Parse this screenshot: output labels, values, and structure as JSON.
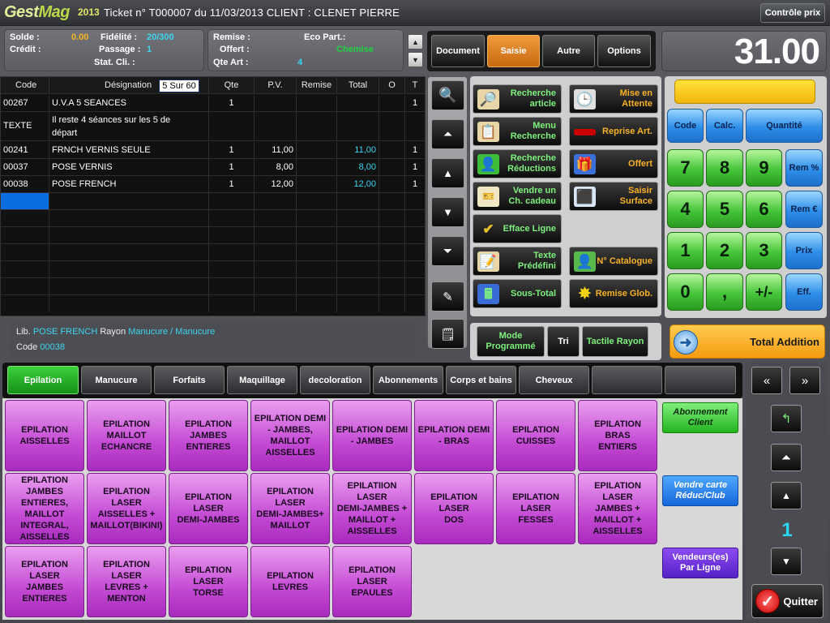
{
  "app": {
    "logo_a": "Gest",
    "logo_b": "Mag",
    "year": "2013",
    "title": "Ticket n° T000007 du 11/03/2013 CLIENT : CLENET PIERRE",
    "control_price": "Contrôle prix"
  },
  "client": {
    "solde_label": "Solde :",
    "solde_value": "0.00",
    "credit_label": "Crédit :",
    "fidelite_label": "Fidélité :",
    "fidelite_value": "20/300",
    "passage_label": "Passage :",
    "passage_value": "1",
    "stat_label": "Stat. Cli. :"
  },
  "sale": {
    "remise_label": "Remise :",
    "offert_label": "Offert :",
    "qte_label": "Qte Art :",
    "qte_value": "4",
    "eco_label": "Eco Part.:",
    "eco_value": "Chemise"
  },
  "modes": {
    "document": "Document",
    "saisie": "Saisie",
    "autre": "Autre",
    "options": "Options"
  },
  "total": "31.00",
  "table": {
    "headers": {
      "code": "Code",
      "designation": "Désignation",
      "qte": "Qte",
      "pv": "P.V.",
      "remise": "Remise",
      "total": "Total",
      "o": "O",
      "t": "T"
    },
    "page": "5 Sur 60",
    "rows": [
      {
        "code": "00267",
        "designation": "U.V.A 5 SEANCES",
        "qte": "1",
        "pv": "",
        "total": "",
        "t": "1"
      },
      {
        "code": "TEXTE",
        "designation": "Il reste 4 séances sur les 5 de",
        "designation2": "départ",
        "qte": "",
        "pv": "",
        "total": "",
        "t": ""
      },
      {
        "code": "00241",
        "designation": "FRNCH VERNIS SEULE",
        "qte": "1",
        "pv": "11,00",
        "total": "11,00",
        "t": "1"
      },
      {
        "code": "00037",
        "designation": "POSE VERNIS",
        "qte": "1",
        "pv": "8,00",
        "total": "8,00",
        "t": "1"
      },
      {
        "code": "00038",
        "designation": "POSE FRENCH",
        "qte": "1",
        "pv": "12,00",
        "total": "12,00",
        "t": "1"
      }
    ]
  },
  "lib": {
    "label": "Lib.",
    "value": "POSE FRENCH",
    "rayon_label": "Rayon",
    "rayon_value": "Manucure / Manucure",
    "code_label": "Code",
    "code_value": "00038"
  },
  "functions": {
    "recherche_article": [
      "Recherche",
      "article"
    ],
    "menu_recherche": [
      "Menu",
      "Recherche"
    ],
    "recherche_reductions": [
      "Recherche",
      "Réductions"
    ],
    "vendre_cheque": [
      "Vendre un",
      "Ch. cadeau"
    ],
    "efface_ligne": "Efface Ligne",
    "texte_predefini": [
      "Texte",
      "Prédéfini"
    ],
    "sous_total": "Sous-Total",
    "mise_en_attente": [
      "Mise en",
      "Attente"
    ],
    "reprise_art": "Reprise Art.",
    "offert": "Offert",
    "saisir_surface": [
      "Saisir",
      "Surface"
    ],
    "no_catalogue": "N° Catalogue",
    "remise_glob": "Remise Glob.",
    "mode_programme": [
      "Mode",
      "Programmé"
    ],
    "tri": "Tri",
    "tactile_rayon": "Tactile Rayon"
  },
  "keypad": {
    "code": "Code",
    "calc": "Calc.",
    "quantite": "Quantité",
    "rem_pct": "Rem %",
    "rem_eur": "Rem €",
    "prix": "Prix",
    "eff": "Eff.",
    "k7": "7",
    "k8": "8",
    "k9": "9",
    "k4": "4",
    "k5": "5",
    "k6": "6",
    "k1": "1",
    "k2": "2",
    "k3": "3",
    "k0": "0",
    "comma": ",",
    "plusminus": "+/-"
  },
  "total_addition": "Total Addition",
  "categories": [
    "Epilation",
    "Manucure",
    "Forfaits",
    "Maquillage",
    "decoloration",
    "Abonnements",
    "Corps et bains",
    "Cheveux",
    "",
    ""
  ],
  "products": [
    [
      "EPILATION",
      "AISSELLES"
    ],
    [
      "EPILATION",
      "MAILLOT",
      "ECHANCRE"
    ],
    [
      "EPILATION",
      "JAMBES",
      "ENTIERES"
    ],
    [
      "EPILATION DEMI",
      "- JAMBES,",
      "MAILLOT",
      "AISSELLES"
    ],
    [
      "EPILATION DEMI",
      "- JAMBES"
    ],
    [
      "EPILATION DEMI",
      "- BRAS"
    ],
    [
      "EPILATION",
      "CUISSES"
    ],
    [
      "EPILATION BRAS",
      "ENTIERS"
    ],
    [
      "EPILATION",
      "JAMBES",
      "ENTIERES,",
      "MAILLOT",
      "INTEGRAL,",
      "AISSELLES"
    ],
    [
      "EPILATION LASER",
      "AISSELLES +",
      "MAILLOT(BIKINI)"
    ],
    [
      "EPILATION LASER",
      "DEMI-JAMBES"
    ],
    [
      "EPILATION LASER",
      "DEMI-JAMBES+",
      "MAILLOT"
    ],
    [
      "EPILATIION",
      "LASER",
      "DEMI-JAMBES +",
      "MAILLOT +",
      "AISSELLES"
    ],
    [
      "EPILATION LASER",
      "DOS"
    ],
    [
      "EPILATION LASER",
      "FESSES"
    ],
    [
      "EPILATION LASER",
      "JAMBES +",
      "MAILLOT +",
      "AISSELLES"
    ],
    [
      "EPILATION LASER",
      "JAMBES",
      "ENTIERES"
    ],
    [
      "EPILATION LASER",
      "LEVRES +",
      "MENTON"
    ],
    [
      "EPILATION LASER",
      "TORSE"
    ],
    [
      "EPILATION",
      "LEVRES"
    ],
    [
      "EPILATION LASER",
      "EPAULES"
    ]
  ],
  "side": {
    "abonnement": [
      "Abonnement",
      "Client"
    ],
    "vendre_carte": [
      "Vendre carte",
      "Réduc/Club"
    ],
    "vendeurs": [
      "Vendeurs(es)",
      "Par Ligne"
    ]
  },
  "pager": {
    "page": "1"
  },
  "quit": "Quitter"
}
